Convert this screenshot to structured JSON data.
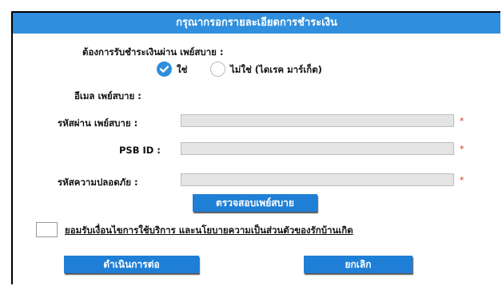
{
  "header": {
    "title": "กรุณากรอกรายละเอียดการชำระเงิน"
  },
  "payment_method": {
    "question": "ต้องการรับชำระเงินผ่าน เพย์สบาย :",
    "option_yes": "ใช่",
    "option_no": "ไม่ใช่ (ไดเรค มาร์เก็ต)",
    "selected": "ใช่"
  },
  "form": {
    "email_label": "อีเมล เพย์สบาย :",
    "password_label": "รหัสผ่าน เพย์สบาย :",
    "psb_id_label": "PSB ID :",
    "security_code_label": "รหัสความปลอดภัย :",
    "password_value": "",
    "psb_id_value": "",
    "security_code_value": "",
    "required_mark": "*"
  },
  "verify_button": {
    "label": "ตรวจสอบเพย์สบาย"
  },
  "terms": {
    "label": "ยอมรับเงื่อนไขการใช้บริการ และนโยบายความเป็นส่วนตัวของรักบ้านเกิด",
    "checked": false
  },
  "actions": {
    "continue_label": "ดำเนินการต่อ",
    "cancel_label": "ยกเลิก"
  },
  "colors": {
    "accent": "#2f8fde",
    "button": "#1f7fd6",
    "required": "#e0301e"
  }
}
